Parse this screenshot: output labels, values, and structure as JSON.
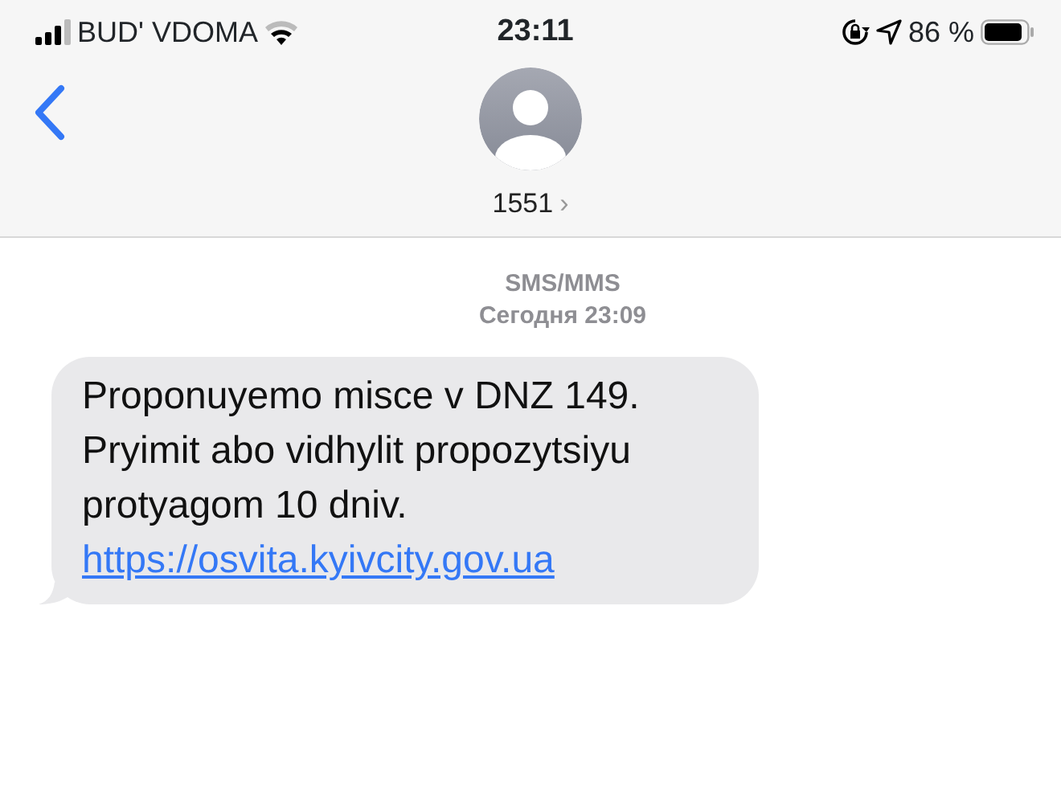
{
  "status_bar": {
    "carrier": "BUD' VDOMA",
    "time": "23:11",
    "battery_percent": "86 %"
  },
  "header": {
    "contact": "1551",
    "chevron": "›"
  },
  "thread": {
    "service": "SMS/MMS",
    "timestamp": "Сегодня 23:09"
  },
  "messages": [
    {
      "kind": "incoming",
      "text": "Proponuyemo misce v DNZ 149. Pryimit abo vidhylit propozytsiyu protyagom 10 dniv.",
      "link": "https://osvita.kyivcity.gov.ua"
    }
  ]
}
